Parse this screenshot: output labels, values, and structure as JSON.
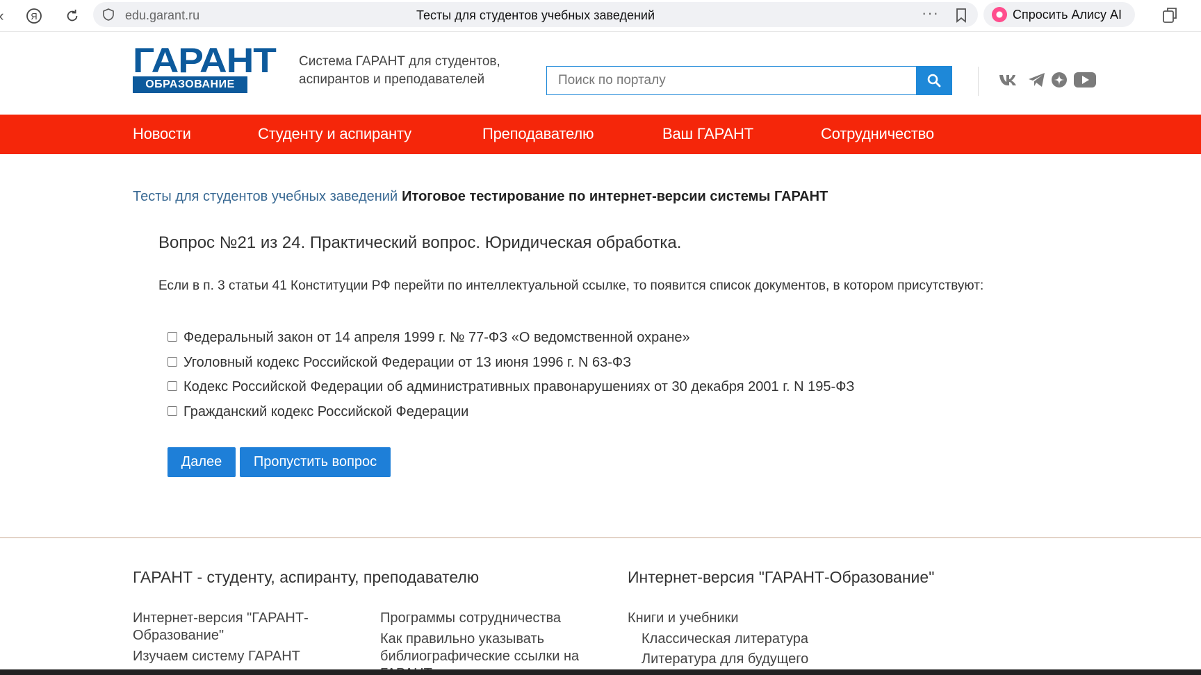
{
  "browser": {
    "domain": "edu.garant.ru",
    "tab_title": "Тесты для студентов учебных заведений",
    "alice_label": "Спросить Алису AI",
    "icons": [
      "yandex-icon",
      "reload-icon",
      "shield-icon",
      "more-icon",
      "bookmark-icon",
      "alice-icon",
      "extensions-icon"
    ]
  },
  "header": {
    "logo_word": "ГАРАНТ",
    "logo_sub": "ОБРАЗОВАНИЕ",
    "tagline": "Система ГАРАНТ для студентов, аспирантов и преподавателей",
    "search_placeholder": "Поиск по порталу",
    "social": [
      "vk-icon",
      "telegram-icon",
      "dzen-icon",
      "youtube-icon"
    ]
  },
  "nav": {
    "items": [
      "Новости",
      "Студенту и аспиранту",
      "Преподавателю",
      "Ваш ГАРАНТ",
      "Сотрудничество"
    ]
  },
  "breadcrumb": {
    "link": "Тесты для студентов учебных заведений",
    "current": "Итоговое тестирование по интернет-версии системы ГАРАНТ"
  },
  "question": {
    "title": "Вопрос №21 из 24. Практический вопрос. Юридическая обработка.",
    "text": "Если в п. 3 статьи 41 Конституции РФ перейти по интеллектуальной ссылке, то появится список документов, в котором присутствуют:",
    "options": [
      "Федеральный закон от 14 апреля 1999 г. № 77-ФЗ «О ведомственной охране»",
      "Уголовный кодекс Российской Федерации от 13 июня 1996 г. N 63-ФЗ",
      "Кодекс Российской Федерации об административных правонарушениях от 30 декабря 2001 г. N 195-ФЗ",
      "Гражданский кодекс Российской Федерации"
    ],
    "next_label": "Далее",
    "skip_label": "Пропустить вопрос"
  },
  "footer": {
    "col1_heading": "ГАРАНТ - студенту, аспиранту, преподавателю",
    "col1_links": [
      "Интернет-версия \"ГАРАНТ-Образование\"",
      "Изучаем систему ГАРАНТ"
    ],
    "col2_links": [
      "Программы сотрудничества",
      "Как правильно указывать библиографические ссылки на ГАРАНТ"
    ],
    "col3_heading": "Интернет-версия \"ГАРАНТ-Образование\"",
    "col3_links": [
      "Книги и учебники",
      "Классическая литература",
      "Литература для будущего"
    ]
  },
  "colors": {
    "nav_bg": "#f5260a",
    "brand_blue": "#0d5a9c",
    "button_blue": "#1e7fd8",
    "link": "#3a6a94"
  }
}
